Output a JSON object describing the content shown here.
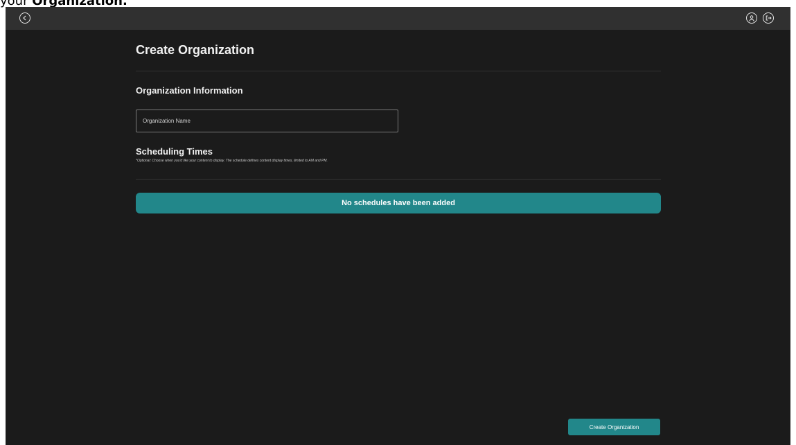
{
  "caption": {
    "prefix": "your ",
    "bold": "Organization."
  },
  "topbar": {
    "back_icon": "chevron-left-circle-icon",
    "profile_icon": "user-circle-icon",
    "logout_icon": "logout-circle-icon"
  },
  "page": {
    "title": "Create Organization"
  },
  "org_info": {
    "heading": "Organization Information",
    "name_placeholder": "Organization Name",
    "name_value": ""
  },
  "scheduling": {
    "heading": "Scheduling Times",
    "note": "*Optional: Choose when you'd like your content to display. The schedule defines content display times, limited to AM and PM.",
    "empty_message": "No schedules have been added"
  },
  "actions": {
    "create_label": "Create Organization"
  },
  "colors": {
    "accent": "#22878a",
    "background": "#1b1b1b",
    "topbar": "#303030"
  }
}
